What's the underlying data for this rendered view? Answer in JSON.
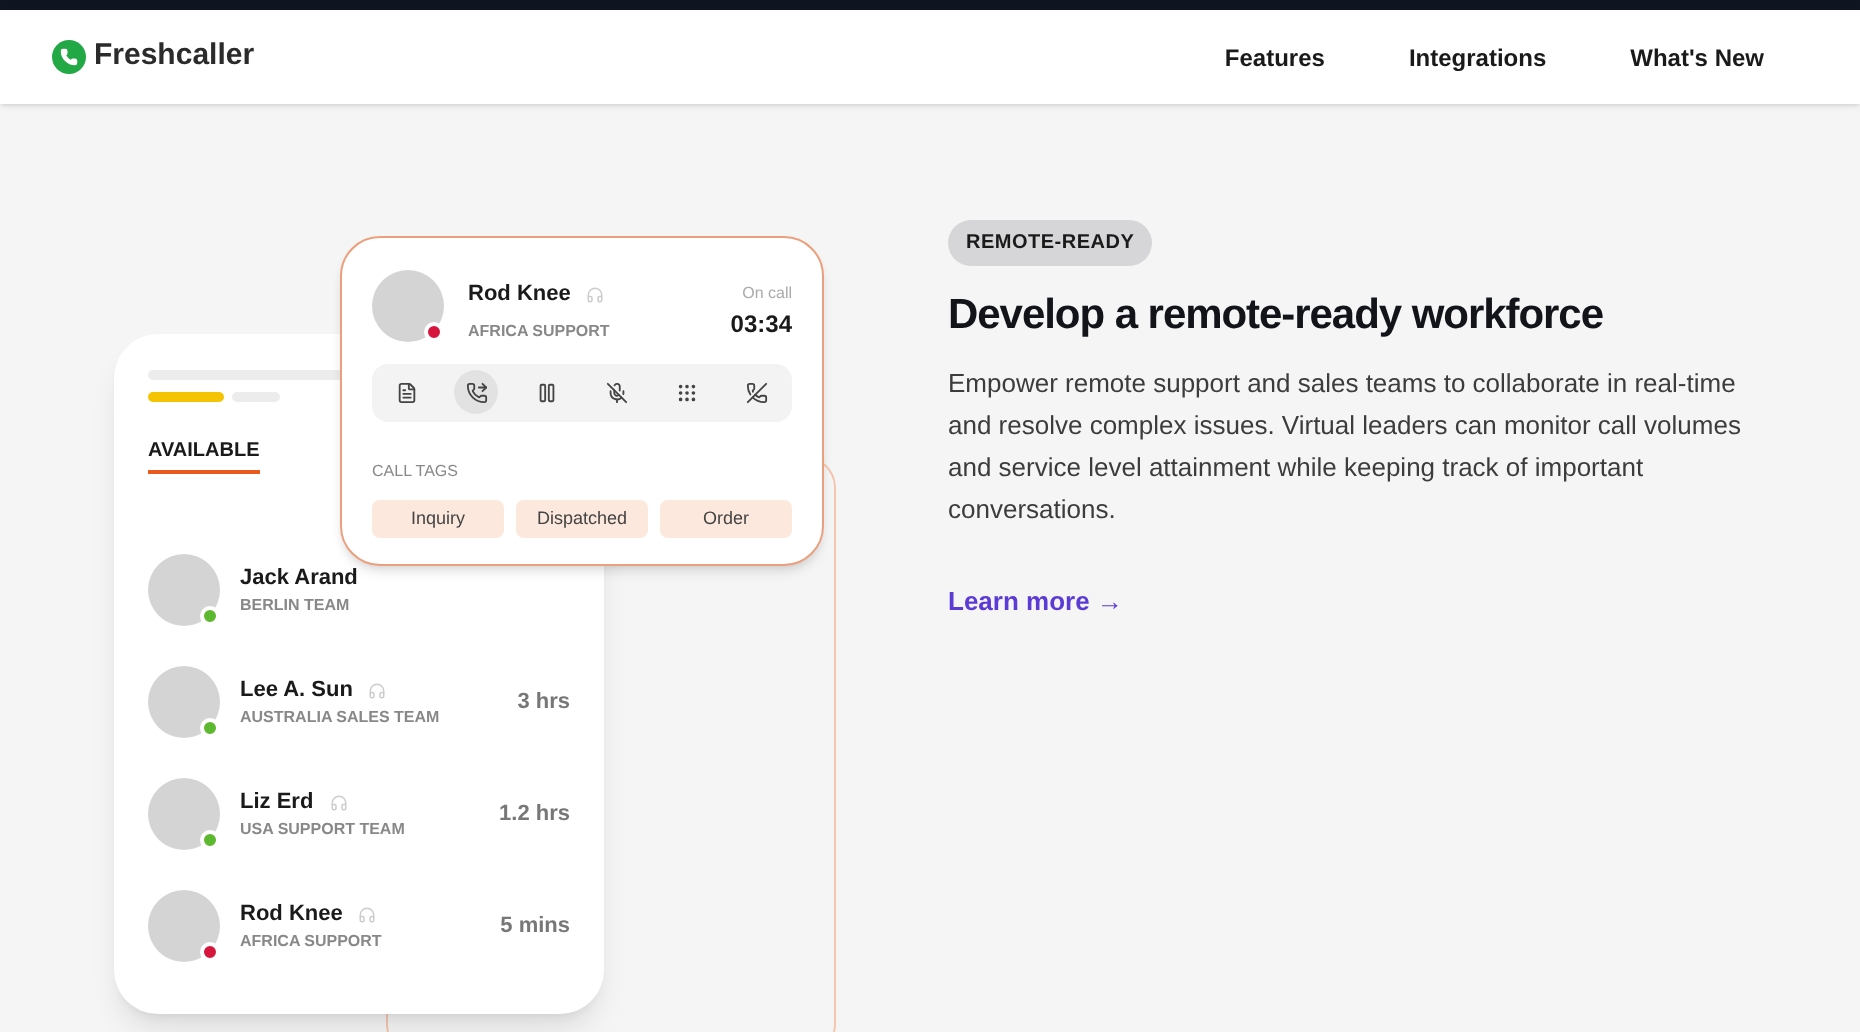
{
  "nav": {
    "brand": "Freshcaller",
    "links": [
      "Features",
      "Integrations",
      "What's New"
    ]
  },
  "agent_list": {
    "tab": "AVAILABLE",
    "agents": [
      {
        "name": "Jack Arand",
        "team": "BERLIN TEAM",
        "color": "#5cb82e"
      },
      {
        "name": "Lee A. Sun",
        "team": "AUSTRALIA SALES TEAM",
        "time": "3 hrs",
        "color": "#5cb82e"
      },
      {
        "name": "Liz Erd",
        "team": "USA SUPPORT TEAM",
        "time": "1.2 hrs",
        "color": "#5cb82e"
      },
      {
        "name": "Rod Knee",
        "team": "AFRICA SUPPORT",
        "time": "5 mins",
        "color": "#d6163c"
      }
    ]
  },
  "call_card": {
    "name": "Rod Knee",
    "team": "AFRICA SUPPORT",
    "color": "#d6163c",
    "status": "On call",
    "timer": "03:34",
    "controls": [
      {
        "kind": "notes",
        "selected": false
      },
      {
        "kind": "transfer",
        "selected": true
      },
      {
        "kind": "pause",
        "selected": false
      },
      {
        "kind": "mute",
        "selected": false
      },
      {
        "kind": "keypad",
        "selected": false
      },
      {
        "kind": "hangup",
        "selected": false
      }
    ],
    "tags_label": "CALL TAGS",
    "tags": [
      "Inquiry",
      "Dispatched",
      "Order"
    ]
  },
  "content": {
    "badge": "REMOTE-READY",
    "heading": "Develop a remote-ready workforce",
    "body": "Empower remote support and sales teams to collaborate in real-time and resolve complex issues. Virtual leaders can monitor call volumes and service level attainment while keeping track of important conversations.",
    "link": "Learn more →"
  }
}
